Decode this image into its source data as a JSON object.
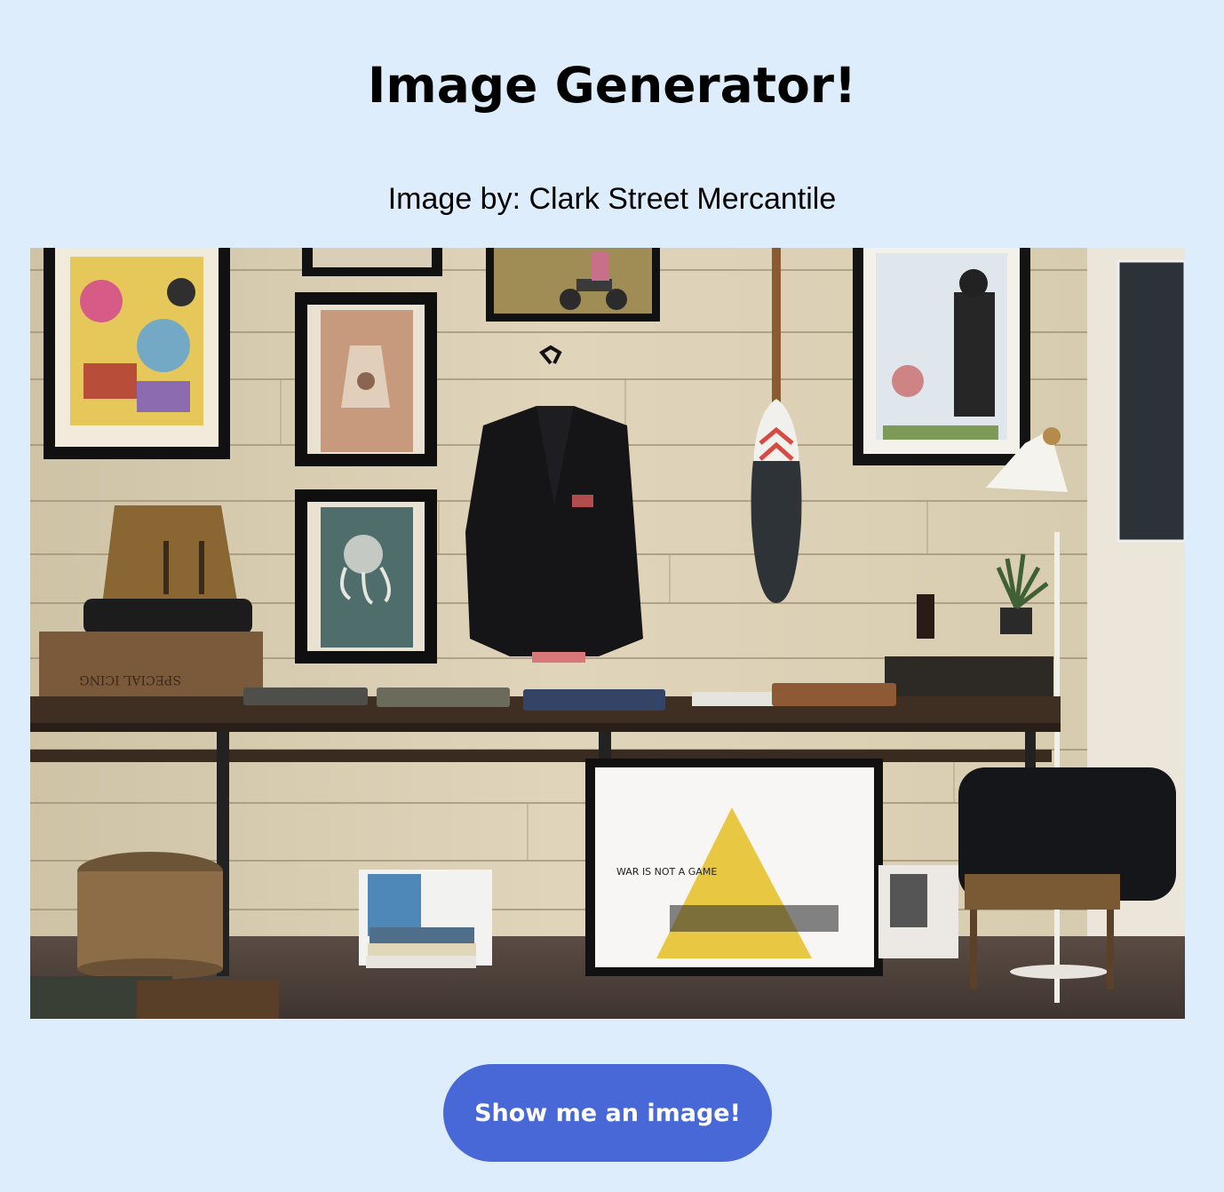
{
  "header": {
    "title": "Image Generator!"
  },
  "image": {
    "credit": "Image by: Clark Street Mercantile",
    "alt": "Shop interior with framed art, a hanging blazer, a canoe paddle, and a wooden display bench",
    "poster_text": "WAR IS NOT A GAME",
    "crate_text": "SPECIAL ICING"
  },
  "actions": {
    "show_label": "Show me an image!"
  },
  "colors": {
    "background": "#deedfb",
    "button": "#4868d8",
    "button_text": "#ffffff"
  }
}
